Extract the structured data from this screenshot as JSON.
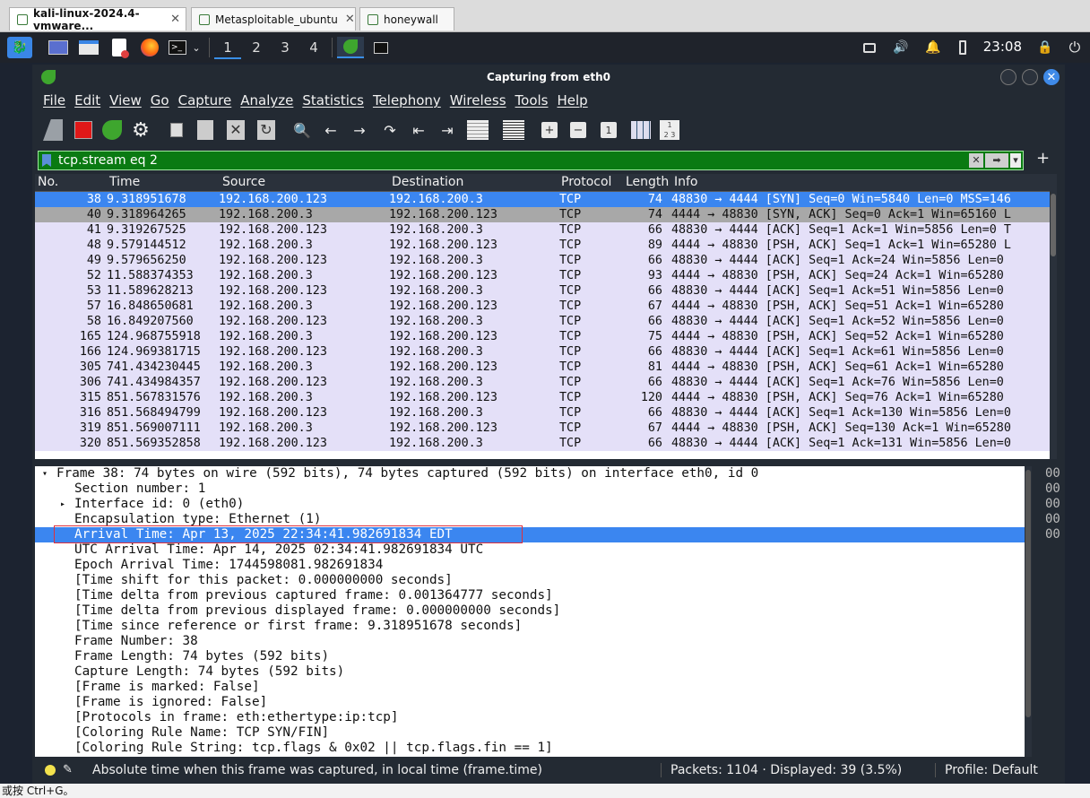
{
  "vm_tabs": [
    {
      "label": "kali-linux-2024.4-vmware...",
      "active": true
    },
    {
      "label": "Metasploitable_ubuntu",
      "active": false
    },
    {
      "label": "honeywall",
      "active": false
    }
  ],
  "panel": {
    "workspaces": [
      "1",
      "2",
      "3",
      "4"
    ],
    "time": "23:08"
  },
  "window": {
    "title": "Capturing from eth0"
  },
  "menu": [
    "File",
    "Edit",
    "View",
    "Go",
    "Capture",
    "Analyze",
    "Statistics",
    "Telephony",
    "Wireless",
    "Tools",
    "Help"
  ],
  "filter": {
    "value": "tcp.stream eq 2"
  },
  "packet_list": {
    "columns": [
      "No.",
      "Time",
      "Source",
      "Destination",
      "Protocol",
      "Length",
      "Info"
    ],
    "rows": [
      {
        "no": "38",
        "time": "9.318951678",
        "src": "192.168.200.123",
        "dst": "192.168.200.3",
        "proto": "TCP",
        "len": "74",
        "info": "48830 → 4444 [SYN] Seq=0 Win=5840 Len=0 MSS=146"
      },
      {
        "no": "40",
        "time": "9.318964265",
        "src": "192.168.200.3",
        "dst": "192.168.200.123",
        "proto": "TCP",
        "len": "74",
        "info": "4444 → 48830 [SYN, ACK] Seq=0 Ack=1 Win=65160 L"
      },
      {
        "no": "41",
        "time": "9.319267525",
        "src": "192.168.200.123",
        "dst": "192.168.200.3",
        "proto": "TCP",
        "len": "66",
        "info": "48830 → 4444 [ACK] Seq=1 Ack=1 Win=5856 Len=0 T"
      },
      {
        "no": "48",
        "time": "9.579144512",
        "src": "192.168.200.3",
        "dst": "192.168.200.123",
        "proto": "TCP",
        "len": "89",
        "info": "4444 → 48830 [PSH, ACK] Seq=1 Ack=1 Win=65280 L"
      },
      {
        "no": "49",
        "time": "9.579656250",
        "src": "192.168.200.123",
        "dst": "192.168.200.3",
        "proto": "TCP",
        "len": "66",
        "info": "48830 → 4444 [ACK] Seq=1 Ack=24 Win=5856 Len=0"
      },
      {
        "no": "52",
        "time": "11.588374353",
        "src": "192.168.200.3",
        "dst": "192.168.200.123",
        "proto": "TCP",
        "len": "93",
        "info": "4444 → 48830 [PSH, ACK] Seq=24 Ack=1 Win=65280"
      },
      {
        "no": "53",
        "time": "11.589628213",
        "src": "192.168.200.123",
        "dst": "192.168.200.3",
        "proto": "TCP",
        "len": "66",
        "info": "48830 → 4444 [ACK] Seq=1 Ack=51 Win=5856 Len=0"
      },
      {
        "no": "57",
        "time": "16.848650681",
        "src": "192.168.200.3",
        "dst": "192.168.200.123",
        "proto": "TCP",
        "len": "67",
        "info": "4444 → 48830 [PSH, ACK] Seq=51 Ack=1 Win=65280"
      },
      {
        "no": "58",
        "time": "16.849207560",
        "src": "192.168.200.123",
        "dst": "192.168.200.3",
        "proto": "TCP",
        "len": "66",
        "info": "48830 → 4444 [ACK] Seq=1 Ack=52 Win=5856 Len=0"
      },
      {
        "no": "165",
        "time": "124.968755918",
        "src": "192.168.200.3",
        "dst": "192.168.200.123",
        "proto": "TCP",
        "len": "75",
        "info": "4444 → 48830 [PSH, ACK] Seq=52 Ack=1 Win=65280"
      },
      {
        "no": "166",
        "time": "124.969381715",
        "src": "192.168.200.123",
        "dst": "192.168.200.3",
        "proto": "TCP",
        "len": "66",
        "info": "48830 → 4444 [ACK] Seq=1 Ack=61 Win=5856 Len=0"
      },
      {
        "no": "305",
        "time": "741.434230445",
        "src": "192.168.200.3",
        "dst": "192.168.200.123",
        "proto": "TCP",
        "len": "81",
        "info": "4444 → 48830 [PSH, ACK] Seq=61 Ack=1 Win=65280"
      },
      {
        "no": "306",
        "time": "741.434984357",
        "src": "192.168.200.123",
        "dst": "192.168.200.3",
        "proto": "TCP",
        "len": "66",
        "info": "48830 → 4444 [ACK] Seq=1 Ack=76 Win=5856 Len=0"
      },
      {
        "no": "315",
        "time": "851.567831576",
        "src": "192.168.200.3",
        "dst": "192.168.200.123",
        "proto": "TCP",
        "len": "120",
        "info": "4444 → 48830 [PSH, ACK] Seq=76 Ack=1 Win=65280"
      },
      {
        "no": "316",
        "time": "851.568494799",
        "src": "192.168.200.123",
        "dst": "192.168.200.3",
        "proto": "TCP",
        "len": "66",
        "info": "48830 → 4444 [ACK] Seq=1 Ack=130 Win=5856 Len=0"
      },
      {
        "no": "319",
        "time": "851.569007111",
        "src": "192.168.200.3",
        "dst": "192.168.200.123",
        "proto": "TCP",
        "len": "67",
        "info": "4444 → 48830 [PSH, ACK] Seq=130 Ack=1 Win=65280"
      },
      {
        "no": "320",
        "time": "851.569352858",
        "src": "192.168.200.123",
        "dst": "192.168.200.3",
        "proto": "TCP",
        "len": "66",
        "info": "48830 → 4444 [ACK] Seq=1 Ack=131 Win=5856 Len=0"
      }
    ]
  },
  "details": {
    "frame_line": "Frame 38: 74 bytes on wire (592 bits), 74 bytes captured (592 bits) on interface eth0, id 0",
    "lines": [
      "Section number: 1",
      "Interface id: 0 (eth0)",
      "Encapsulation type: Ethernet (1)",
      "Arrival Time: Apr 13, 2025 22:34:41.982691834 EDT",
      "UTC Arrival Time: Apr 14, 2025 02:34:41.982691834 UTC",
      "Epoch Arrival Time: 1744598081.982691834",
      "[Time shift for this packet: 0.000000000 seconds]",
      "[Time delta from previous captured frame: 0.001364777 seconds]",
      "[Time delta from previous displayed frame: 0.000000000 seconds]",
      "[Time since reference or first frame: 9.318951678 seconds]",
      "Frame Number: 38",
      "Frame Length: 74 bytes (592 bits)",
      "Capture Length: 74 bytes (592 bits)",
      "[Frame is marked: False]",
      "[Frame is ignored: False]",
      "[Protocols in frame: eth:ethertype:ip:tcp]",
      "[Coloring Rule Name: TCP SYN/FIN]",
      "[Coloring Rule String: tcp.flags & 0x02 || tcp.flags.fin == 1]"
    ],
    "hex": [
      "00",
      "00",
      "00",
      "00",
      "00"
    ]
  },
  "status": {
    "field_desc": "Absolute time when this frame was captured, in local time (frame.time)",
    "packets": "Packets: 1104 · Displayed: 39 (3.5%)",
    "profile": "Profile: Default"
  },
  "host_hint": "或按 Ctrl+G。",
  "colors": {
    "selected": "#3b86f0",
    "row_tcp": "#e4e0f8",
    "filter_ok": "#0a7a12",
    "annotation": "#e0303c"
  }
}
